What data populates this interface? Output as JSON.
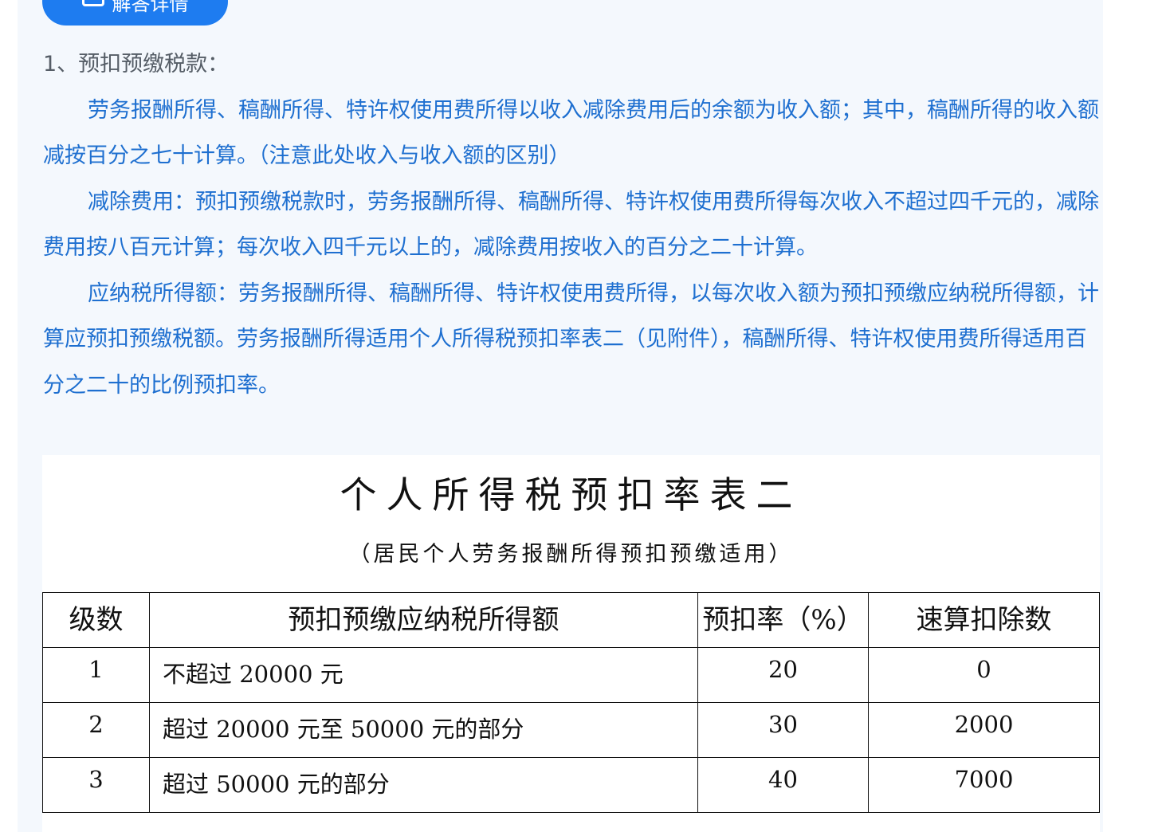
{
  "detail_button": {
    "label": "解答详情",
    "icon": "message-icon"
  },
  "article": {
    "heading": "1、预扣预缴税款：",
    "paragraphs": [
      "劳务报酬所得、稿酬所得、特许权使用费所得以收入减除费用后的余额为收入额；其中，稿酬所得的收入额减按百分之七十计算。（注意此处收入与收入额的区别）",
      "减除费用：预扣预缴税款时，劳务报酬所得、稿酬所得、特许权使用费所得每次收入不超过四千元的，减除费用按八百元计算；每次收入四千元以上的，减除费用按收入的百分之二十计算。",
      "应纳税所得额：劳务报酬所得、稿酬所得、特许权使用费所得，以每次收入额为预扣预缴应纳税所得额，计算应预扣预缴税额。劳务报酬所得适用个人所得税预扣率表二（见附件），稿酬所得、特许权使用费所得适用百分之二十的比例预扣率。"
    ]
  },
  "rate_table": {
    "title": "个人所得税预扣率表二",
    "subtitle": "（居民个人劳务报酬所得预扣预缴适用）",
    "headers": [
      "级数",
      "预扣预缴应纳税所得额",
      "预扣率（%）",
      "速算扣除数"
    ],
    "rows": [
      [
        "1",
        "不超过 20000 元",
        "20",
        "0"
      ],
      [
        "2",
        "超过 20000 元至 50000 元的部分",
        "30",
        "2000"
      ],
      [
        "3",
        "超过 50000 元的部分",
        "40",
        "7000"
      ]
    ]
  },
  "colors": {
    "accent": "#1e7cf0",
    "text_blue": "#1e6fd0",
    "panel_bg": "#f4f8fd"
  }
}
